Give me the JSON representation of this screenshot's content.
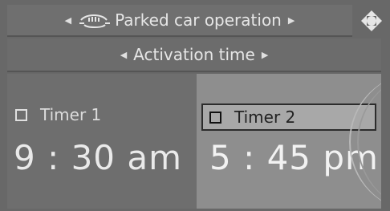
{
  "header": {
    "title": "Parked car operation",
    "icon": "car-icon"
  },
  "subheader": {
    "title": "Activation time"
  },
  "timers": [
    {
      "label": "Timer 1",
      "time": "9 : 30 am",
      "selected": false
    },
    {
      "label": "Timer 2",
      "time": "5 : 45 pm",
      "selected": true
    }
  ],
  "colors": {
    "background": "#686868",
    "highlight": "#8e8e8e",
    "text": "#e6e6e6"
  }
}
